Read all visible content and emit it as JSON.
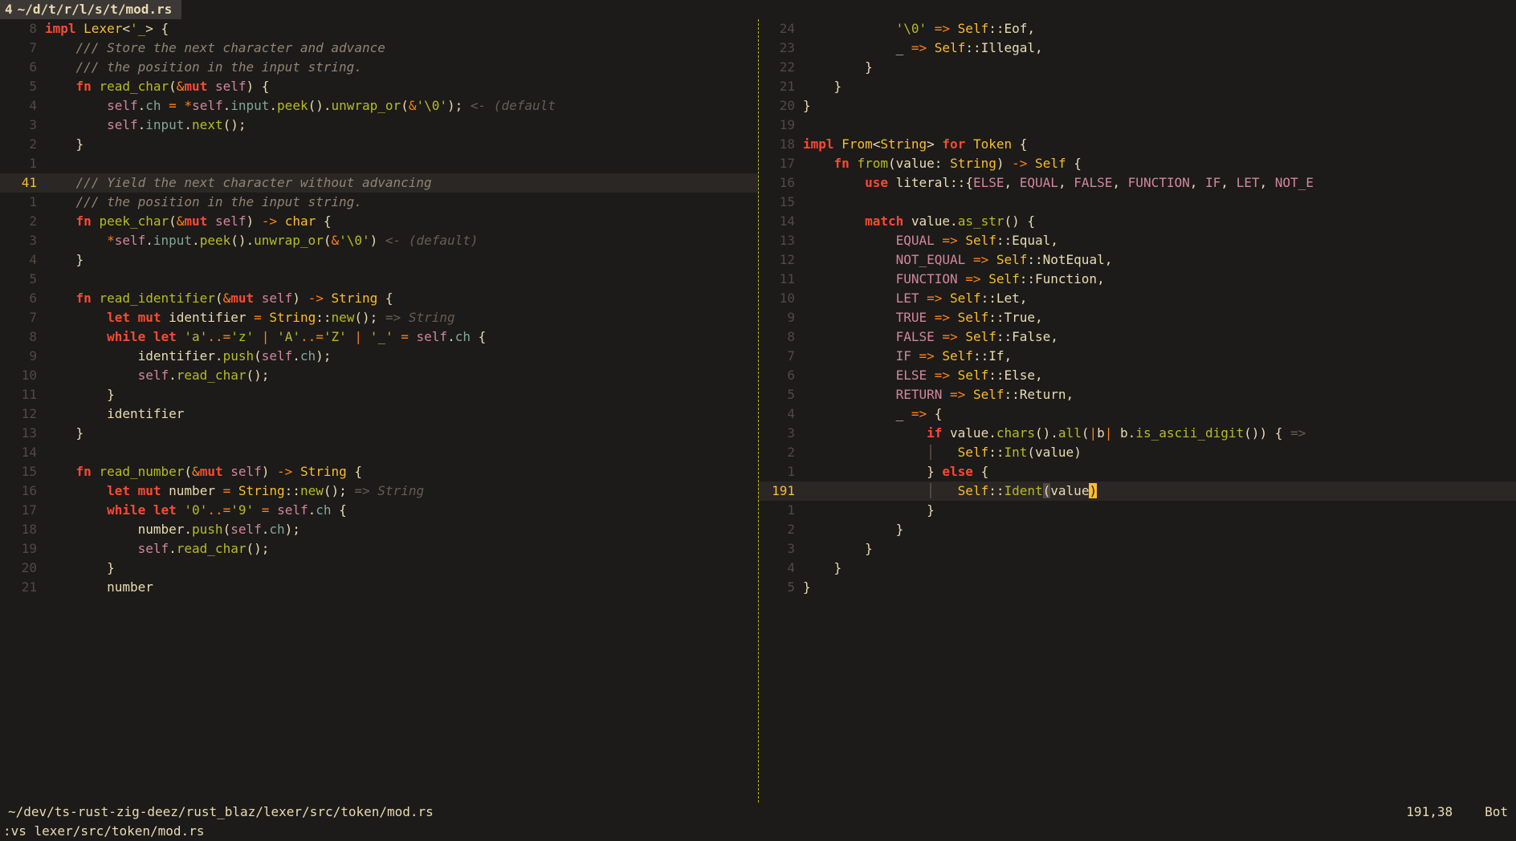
{
  "tab": {
    "num": "4",
    "path": "~/d/t/r/l/s/t/mod.rs"
  },
  "left": {
    "lines": [
      {
        "n": "8",
        "html": "<span class='kw'>impl</span> <span class='type'>Lexer</span><span class='punct'>&lt;</span><span class='str'>'_</span><span class='punct'>&gt; {</span>"
      },
      {
        "n": "7",
        "html": "    <span class='comment'>/// Store the next character and advance</span>"
      },
      {
        "n": "6",
        "html": "    <span class='comment'>/// the position in the input string.</span>"
      },
      {
        "n": "5",
        "html": "    <span class='kw'>fn</span> <span class='fn'>read_char</span><span class='punct'>(</span><span class='op'>&amp;</span><span class='kw'>mut</span> <span class='self'>self</span><span class='punct'>) {</span>"
      },
      {
        "n": "4",
        "html": "        <span class='self'>self</span><span class='punct'>.</span><span class='field'>ch</span> <span class='op'>=</span> <span class='op'>*</span><span class='self'>self</span><span class='punct'>.</span><span class='field'>input</span><span class='punct'>.</span><span class='fn'>peek</span><span class='punct'>().</span><span class='fn'>unwrap_or</span><span class='punct'>(</span><span class='op'>&amp;</span><span class='char'>'\\0'</span><span class='punct'>);</span> <span class='hint'>&lt;- (default</span>"
      },
      {
        "n": "3",
        "html": "        <span class='self'>self</span><span class='punct'>.</span><span class='field'>input</span><span class='punct'>.</span><span class='fn'>next</span><span class='punct'>();</span>"
      },
      {
        "n": "2",
        "html": "    <span class='punct'>}</span>"
      },
      {
        "n": "1",
        "html": ""
      },
      {
        "n": "41",
        "cur": true,
        "html": "    <span class='comment'>/// Yield the next character without advancing</span>"
      },
      {
        "n": "1",
        "html": "    <span class='comment'>/// the position in the input string.</span>"
      },
      {
        "n": "2",
        "html": "    <span class='kw'>fn</span> <span class='fn'>peek_char</span><span class='punct'>(</span><span class='op'>&amp;</span><span class='kw'>mut</span> <span class='self'>self</span><span class='punct'>)</span> <span class='op'>-&gt;</span> <span class='type'>char</span> <span class='punct'>{</span>"
      },
      {
        "n": "3",
        "html": "        <span class='op'>*</span><span class='self'>self</span><span class='punct'>.</span><span class='field'>input</span><span class='punct'>.</span><span class='fn'>peek</span><span class='punct'>().</span><span class='fn'>unwrap_or</span><span class='punct'>(</span><span class='op'>&amp;</span><span class='char'>'\\0'</span><span class='punct'>)</span> <span class='hint'>&lt;- (default)</span>"
      },
      {
        "n": "4",
        "html": "    <span class='punct'>}</span>"
      },
      {
        "n": "5",
        "html": ""
      },
      {
        "n": "6",
        "html": "    <span class='kw'>fn</span> <span class='fn'>read_identifier</span><span class='punct'>(</span><span class='op'>&amp;</span><span class='kw'>mut</span> <span class='self'>self</span><span class='punct'>)</span> <span class='op'>-&gt;</span> <span class='type'>String</span> <span class='punct'>{</span>"
      },
      {
        "n": "7",
        "html": "        <span class='kw'>let</span> <span class='kw'>mut</span> <span class='var'>identifier</span> <span class='op'>=</span> <span class='type'>String</span><span class='punct'>::</span><span class='fn'>new</span><span class='punct'>();</span> <span class='hint'>=&gt; String</span>"
      },
      {
        "n": "8",
        "html": "        <span class='kw'>while</span> <span class='kw'>let</span> <span class='char'>'a'</span><span class='op'>..=</span><span class='char'>'z'</span> <span class='op'>|</span> <span class='char'>'A'</span><span class='op'>..=</span><span class='char'>'Z'</span> <span class='op'>|</span> <span class='char'>'_'</span> <span class='op'>=</span> <span class='self'>self</span><span class='punct'>.</span><span class='field'>ch</span> <span class='punct'>{</span>"
      },
      {
        "n": "9",
        "html": "            <span class='var'>identifier</span><span class='punct'>.</span><span class='fn'>push</span><span class='punct'>(</span><span class='self'>self</span><span class='punct'>.</span><span class='field'>ch</span><span class='punct'>);</span>"
      },
      {
        "n": "10",
        "html": "            <span class='self'>self</span><span class='punct'>.</span><span class='fn'>read_char</span><span class='punct'>();</span>"
      },
      {
        "n": "11",
        "html": "        <span class='punct'>}</span>"
      },
      {
        "n": "12",
        "html": "        <span class='var'>identifier</span>"
      },
      {
        "n": "13",
        "html": "    <span class='punct'>}</span>"
      },
      {
        "n": "14",
        "html": ""
      },
      {
        "n": "15",
        "html": "    <span class='kw'>fn</span> <span class='fn'>read_number</span><span class='punct'>(</span><span class='op'>&amp;</span><span class='kw'>mut</span> <span class='self'>self</span><span class='punct'>)</span> <span class='op'>-&gt;</span> <span class='type'>String</span> <span class='punct'>{</span>"
      },
      {
        "n": "16",
        "html": "        <span class='kw'>let</span> <span class='kw'>mut</span> <span class='var'>number</span> <span class='op'>=</span> <span class='type'>String</span><span class='punct'>::</span><span class='fn'>new</span><span class='punct'>();</span> <span class='hint'>=&gt; String</span>"
      },
      {
        "n": "17",
        "html": "        <span class='kw'>while</span> <span class='kw'>let</span> <span class='char'>'0'</span><span class='op'>..=</span><span class='char'>'9'</span> <span class='op'>=</span> <span class='self'>self</span><span class='punct'>.</span><span class='field'>ch</span> <span class='punct'>{</span>"
      },
      {
        "n": "18",
        "html": "            <span class='var'>number</span><span class='punct'>.</span><span class='fn'>push</span><span class='punct'>(</span><span class='self'>self</span><span class='punct'>.</span><span class='field'>ch</span><span class='punct'>);</span>"
      },
      {
        "n": "19",
        "html": "            <span class='self'>self</span><span class='punct'>.</span><span class='fn'>read_char</span><span class='punct'>();</span>"
      },
      {
        "n": "20",
        "html": "        <span class='punct'>}</span>"
      },
      {
        "n": "21",
        "html": "        <span class='var'>number</span>"
      }
    ]
  },
  "right": {
    "lines": [
      {
        "n": "24",
        "html": "            <span class='char'>'\\0'</span> <span class='op'>=&gt;</span> <span class='type'>Self</span><span class='punct'>::</span><span class='var'>Eof</span><span class='punct'>,</span>"
      },
      {
        "n": "23",
        "html": "            <span class='var'>_</span> <span class='op'>=&gt;</span> <span class='type'>Self</span><span class='punct'>::</span><span class='var'>Illegal</span><span class='punct'>,</span>"
      },
      {
        "n": "22",
        "html": "        <span class='punct'>}</span>"
      },
      {
        "n": "21",
        "html": "    <span class='punct'>}</span>"
      },
      {
        "n": "20",
        "html": "<span class='punct'>}</span>"
      },
      {
        "n": "19",
        "html": ""
      },
      {
        "n": "18",
        "html": "<span class='kw'>impl</span> <span class='type'>From</span><span class='punct'>&lt;</span><span class='type'>String</span><span class='punct'>&gt;</span> <span class='kw'>for</span> <span class='type'>Token</span> <span class='punct'>{</span>"
      },
      {
        "n": "17",
        "html": "    <span class='kw'>fn</span> <span class='fn'>from</span><span class='punct'>(</span><span class='var'>value</span><span class='punct'>:</span> <span class='type'>String</span><span class='punct'>)</span> <span class='op'>-&gt;</span> <span class='type'>Self</span> <span class='punct'>{</span>"
      },
      {
        "n": "16",
        "html": "        <span class='kw'>use</span> <span class='var'>literal</span><span class='punct'>::{</span><span class='const'>ELSE</span><span class='punct'>,</span> <span class='const'>EQUAL</span><span class='punct'>,</span> <span class='const'>FALSE</span><span class='punct'>,</span> <span class='const'>FUNCTION</span><span class='punct'>,</span> <span class='const'>IF</span><span class='punct'>,</span> <span class='const'>LET</span><span class='punct'>,</span> <span class='const'>NOT_E</span>"
      },
      {
        "n": "15",
        "html": ""
      },
      {
        "n": "14",
        "html": "        <span class='kw'>match</span> <span class='var'>value</span><span class='punct'>.</span><span class='fn'>as_str</span><span class='punct'>() {</span>"
      },
      {
        "n": "13",
        "html": "            <span class='const'>EQUAL</span> <span class='op'>=&gt;</span> <span class='type'>Self</span><span class='punct'>::</span><span class='var'>Equal</span><span class='punct'>,</span>"
      },
      {
        "n": "12",
        "html": "            <span class='const'>NOT_EQUAL</span> <span class='op'>=&gt;</span> <span class='type'>Self</span><span class='punct'>::</span><span class='var'>NotEqual</span><span class='punct'>,</span>"
      },
      {
        "n": "11",
        "html": "            <span class='const'>FUNCTION</span> <span class='op'>=&gt;</span> <span class='type'>Self</span><span class='punct'>::</span><span class='var'>Function</span><span class='punct'>,</span>"
      },
      {
        "n": "10",
        "html": "            <span class='const'>LET</span> <span class='op'>=&gt;</span> <span class='type'>Self</span><span class='punct'>::</span><span class='var'>Let</span><span class='punct'>,</span>"
      },
      {
        "n": "9",
        "html": "            <span class='const'>TRUE</span> <span class='op'>=&gt;</span> <span class='type'>Self</span><span class='punct'>::</span><span class='var'>True</span><span class='punct'>,</span>"
      },
      {
        "n": "8",
        "html": "            <span class='const'>FALSE</span> <span class='op'>=&gt;</span> <span class='type'>Self</span><span class='punct'>::</span><span class='var'>False</span><span class='punct'>,</span>"
      },
      {
        "n": "7",
        "html": "            <span class='const'>IF</span> <span class='op'>=&gt;</span> <span class='type'>Self</span><span class='punct'>::</span><span class='var'>If</span><span class='punct'>,</span>"
      },
      {
        "n": "6",
        "html": "            <span class='const'>ELSE</span> <span class='op'>=&gt;</span> <span class='type'>Self</span><span class='punct'>::</span><span class='var'>Else</span><span class='punct'>,</span>"
      },
      {
        "n": "5",
        "html": "            <span class='const'>RETURN</span> <span class='op'>=&gt;</span> <span class='type'>Self</span><span class='punct'>::</span><span class='var'>Return</span><span class='punct'>,</span>"
      },
      {
        "n": "4",
        "html": "            <span class='var'>_</span> <span class='op'>=&gt;</span> <span class='punct'>{</span>"
      },
      {
        "n": "3",
        "html": "                <span class='kw'>if</span> <span class='var'>value</span><span class='punct'>.</span><span class='fn'>chars</span><span class='punct'>().</span><span class='fn'>all</span><span class='punct'>(</span><span class='op'>|</span><span class='var'>b</span><span class='op'>|</span> <span class='var'>b</span><span class='punct'>.</span><span class='fn'>is_ascii_digit</span><span class='punct'>()) {</span> <span class='hint'>=&gt;</span>"
      },
      {
        "n": "2",
        "html": "                <span class='hint'>│</span>   <span class='type'>Self</span><span class='punct'>::</span><span class='fn'>Int</span><span class='punct'>(</span><span class='var'>value</span><span class='punct'>)</span>"
      },
      {
        "n": "1",
        "html": "                <span class='punct'>}</span> <span class='kw'>else</span> <span class='punct'>{</span>"
      },
      {
        "n": "191",
        "cur": true,
        "html": "                <span class='hint'>│</span>   <span class='type'>Self</span><span class='punct'>::</span><span class='fn'>Ident</span><span class='match-paren'>(</span><span class='var'>value</span><span class='cursor-block'>)</span>"
      },
      {
        "n": "1",
        "html": "                <span class='punct'>}</span>"
      },
      {
        "n": "2",
        "html": "            <span class='punct'>}</span>"
      },
      {
        "n": "3",
        "html": "        <span class='punct'>}</span>"
      },
      {
        "n": "4",
        "html": "    <span class='punct'>}</span>"
      },
      {
        "n": "5",
        "html": "<span class='punct'>}</span>"
      }
    ]
  },
  "status": {
    "path": "~/dev/ts-rust-zig-deez/rust_blaz/lexer/src/token/mod.rs",
    "pos": "191,38",
    "scroll": "Bot"
  },
  "cmd": ":vs lexer/src/token/mod.rs"
}
